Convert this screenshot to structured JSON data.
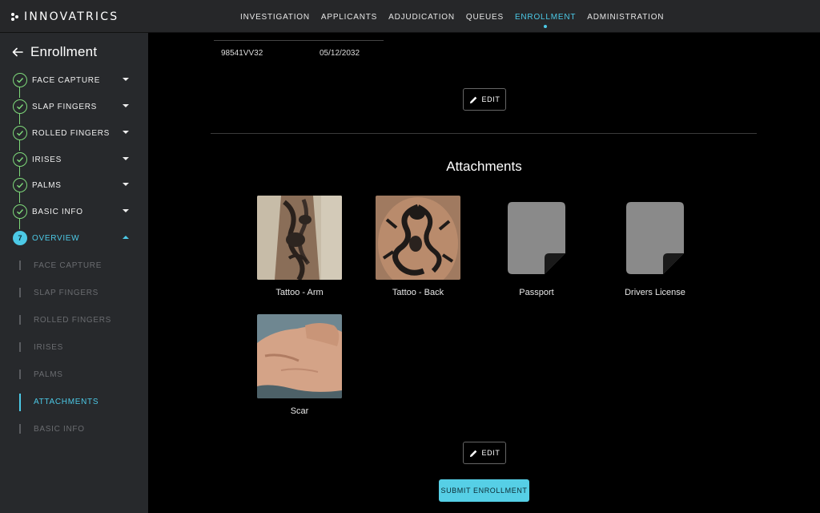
{
  "brand": {
    "name": "INNOVATRICS"
  },
  "nav": {
    "items": [
      {
        "label": "INVESTIGATION"
      },
      {
        "label": "APPLICANTS"
      },
      {
        "label": "ADJUDICATION"
      },
      {
        "label": "QUEUES"
      },
      {
        "label": "ENROLLMENT",
        "active": true
      },
      {
        "label": "ADMINISTRATION"
      }
    ]
  },
  "sidebar": {
    "back_icon": "arrow-left-icon",
    "title": "Enrollment",
    "steps": [
      {
        "label": "FACE CAPTURE",
        "status": "done"
      },
      {
        "label": "SLAP FINGERS",
        "status": "done"
      },
      {
        "label": "ROLLED FINGERS",
        "status": "done"
      },
      {
        "label": "IRISES",
        "status": "done"
      },
      {
        "label": "PALMS",
        "status": "done"
      },
      {
        "label": "BASIC INFO",
        "status": "done"
      },
      {
        "label": "OVERVIEW",
        "status": "current",
        "number": "7"
      }
    ],
    "overview_items": [
      {
        "label": "FACE CAPTURE"
      },
      {
        "label": "SLAP FINGERS"
      },
      {
        "label": "ROLLED FINGERS"
      },
      {
        "label": "IRISES"
      },
      {
        "label": "PALMS"
      },
      {
        "label": "ATTACHMENTS",
        "active": true
      },
      {
        "label": "BASIC INFO"
      }
    ]
  },
  "document_row": {
    "number": "98541VV32",
    "expiry": "05/12/2032"
  },
  "edit_label": "EDIT",
  "attachments": {
    "title": "Attachments",
    "items": [
      {
        "caption": "Tattoo - Arm",
        "kind": "photo"
      },
      {
        "caption": "Tattoo - Back",
        "kind": "photo"
      },
      {
        "caption": "Passport",
        "kind": "document"
      },
      {
        "caption": "Drivers License",
        "kind": "document"
      },
      {
        "caption": "Scar",
        "kind": "photo"
      }
    ]
  },
  "submit_label": "SUBMIT ENROLLMENT",
  "colors": {
    "accent": "#4cc9e6",
    "done": "#7ed97a",
    "sidebar": "#27292c",
    "topbar": "#262729"
  }
}
